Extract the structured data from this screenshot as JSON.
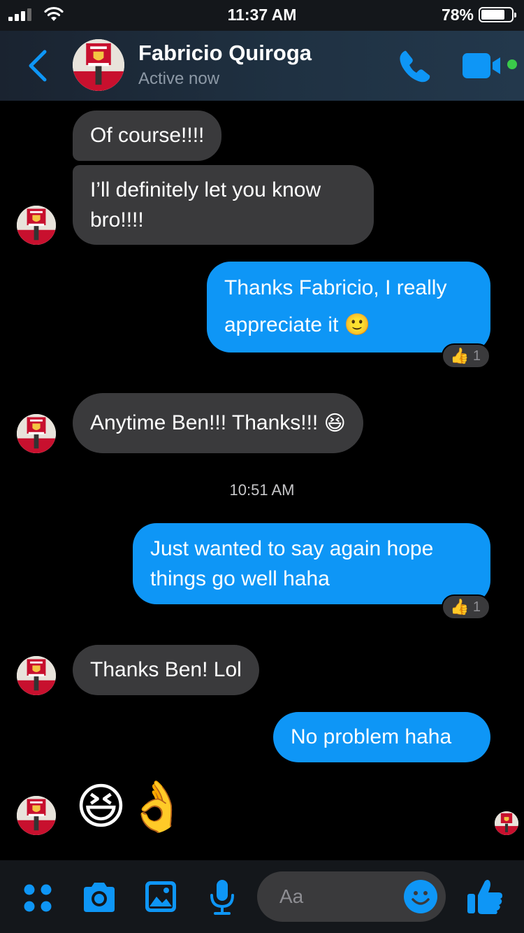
{
  "status_bar": {
    "time": "11:37 AM",
    "battery_percent": "78%",
    "battery_level": 0.78
  },
  "header": {
    "contact_name": "Fabricio Quiroga",
    "presence": "Active now",
    "icons": [
      "chevron-left-icon",
      "phone-icon",
      "video-camera-icon"
    ],
    "accent_color": "#0e96f6",
    "online_color": "#3ac94a"
  },
  "messages": [
    {
      "from": "them",
      "text": "Of course!!!!"
    },
    {
      "from": "them",
      "text": "I’ll definitely let you know bro!!!!"
    },
    {
      "from": "me",
      "text": "Thanks Fabricio, I really appreciate it",
      "emoji": "🙂",
      "reaction": {
        "icon": "👍",
        "count": "1"
      }
    },
    {
      "from": "them",
      "text": "Anytime Ben!!! Thanks!!!",
      "emoji": "😆"
    },
    {
      "from": "me",
      "text": "Just wanted to say again hope things go well haha",
      "reaction": {
        "icon": "👍",
        "count": "1"
      }
    },
    {
      "from": "them",
      "text": "Thanks Ben! Lol"
    },
    {
      "from": "me",
      "text": "No problem haha"
    },
    {
      "from": "them",
      "emojis": "😆👌"
    }
  ],
  "timestamp_divider": "10:51 AM",
  "composer": {
    "placeholder": "Aa",
    "icons": [
      "apps-grid-icon",
      "camera-icon",
      "photo-icon",
      "microphone-icon",
      "emoji-icon",
      "thumbs-up-icon"
    ]
  }
}
